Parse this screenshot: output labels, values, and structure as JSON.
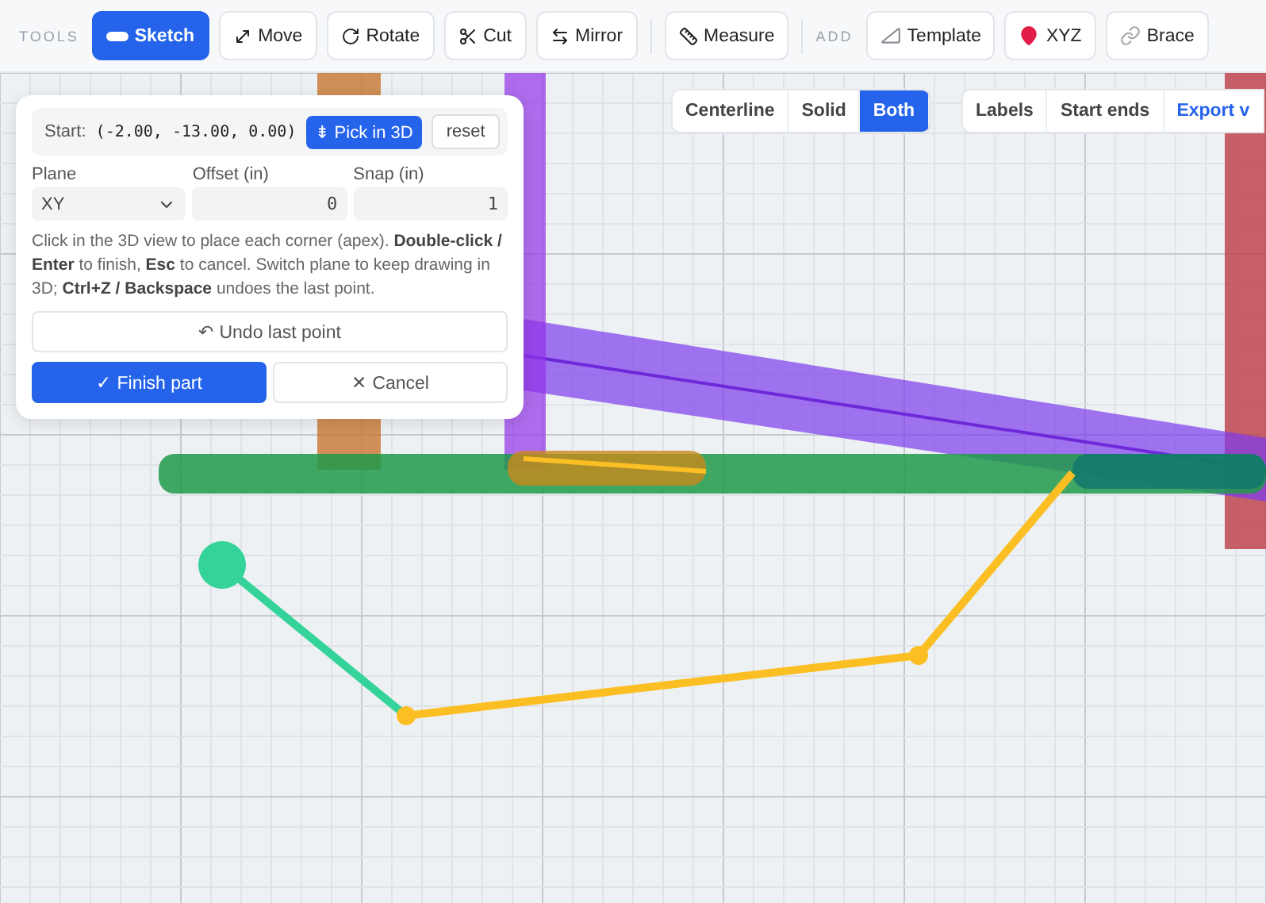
{
  "toolbar": {
    "tools_label": "TOOLS",
    "tools": [
      {
        "label": "Sketch",
        "selected": true
      },
      {
        "label": "Move",
        "selected": false
      },
      {
        "label": "Rotate",
        "selected": false
      },
      {
        "label": "Cut",
        "selected": false
      },
      {
        "label": "Mirror",
        "selected": false
      },
      {
        "label": "Measure",
        "selected": false
      }
    ],
    "add_label": "ADD",
    "add": [
      {
        "label": "Template"
      },
      {
        "label": "XYZ"
      },
      {
        "label": "Brace"
      }
    ]
  },
  "view_modes": [
    {
      "label": "Centerline",
      "selected": false
    },
    {
      "label": "Solid",
      "selected": false
    },
    {
      "label": "Both",
      "selected": true
    }
  ],
  "view_options": [
    {
      "label": "Labels",
      "kind": "toggle"
    },
    {
      "label": "Start ends",
      "kind": "toggle"
    },
    {
      "label": "Export v",
      "kind": "link"
    }
  ],
  "sketch_panel": {
    "start_label": "Start:",
    "start_value": "(-2.00, -13.00, 0.00)",
    "pick_button": "⇟ Pick in 3D",
    "reset_button": "reset",
    "fields": [
      {
        "label": "Plane",
        "value": "XY",
        "kind": "select"
      },
      {
        "label": "Offset (in)",
        "value": "0",
        "kind": "number"
      },
      {
        "label": "Snap (in)",
        "value": "1",
        "kind": "number"
      }
    ],
    "help": "Click in the 3D view to place each corner (apex). **Double-click / Enter** to finish, **Esc** to cancel. Switch plane to keep drawing in 3D; **Ctrl+Z / Backspace** undoes the last point.",
    "undo_button": "↶ Undo last point",
    "finish_button": "✓ Finish part",
    "cancel_button": "✕ Cancel"
  }
}
